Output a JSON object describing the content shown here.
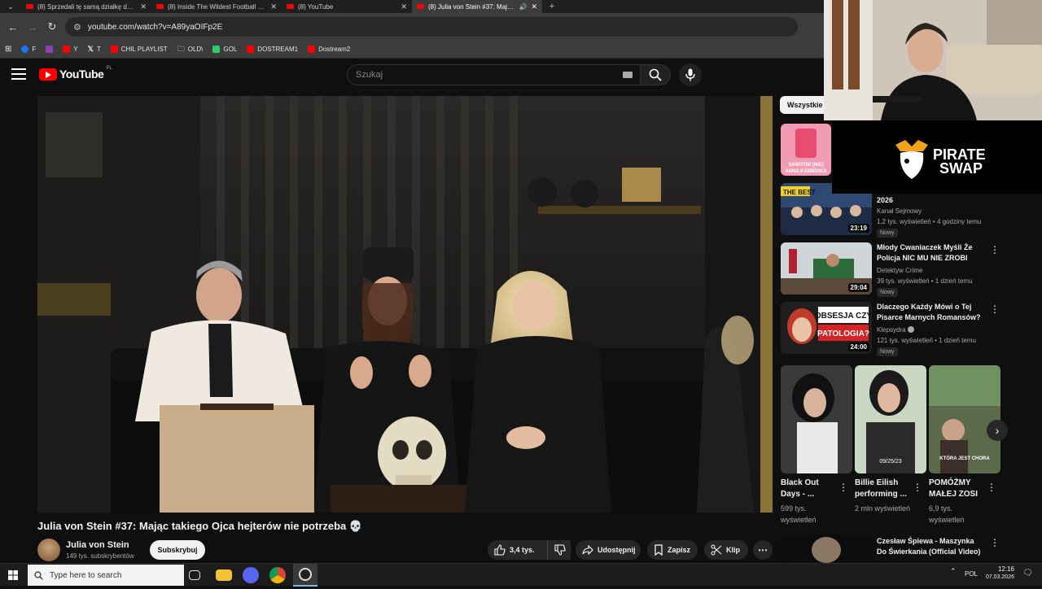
{
  "browser": {
    "tabs": [
      {
        "title": "(8) Sprzedali tę samą działkę dwa razy",
        "active": false
      },
      {
        "title": "(8) Inside The Wildest Football Club",
        "active": false
      },
      {
        "title": "(8) YouTube",
        "active": false
      },
      {
        "title": "(8) Julia von Stein #37: Mając takiego Ojca",
        "active": true
      }
    ],
    "url": "youtube.com/watch?v=A89yaOIFp2E",
    "bookmarks": [
      {
        "label": "F",
        "color": "#1877f2"
      },
      {
        "label": "",
        "color": "#8e44ad"
      },
      {
        "label": "Y",
        "color": "#ff0000"
      },
      {
        "label": "T",
        "color": "#000000"
      },
      {
        "label": "CHIL PLAYLIST",
        "color": "#ff0000"
      },
      {
        "label": "OLD\\",
        "color": "folder"
      },
      {
        "label": "GOL",
        "color": "#2ecc71"
      },
      {
        "label": "DOSTREAM1",
        "color": "#ff0000"
      },
      {
        "label": "Dostream2",
        "color": "#ff0000"
      }
    ]
  },
  "youtube": {
    "logo_text": "YouTube",
    "country": "PL",
    "search_placeholder": "Szukaj"
  },
  "video": {
    "title": "Julia von Stein #37: Mając takiego Ojca hejterów nie potrzeba 💀",
    "channel": "Julia von Stein",
    "subscribers": "149 tys. subskrybentów",
    "subscribe_label": "Subskrybuj",
    "likes": "3,4 tys.",
    "share_label": "Udostępnij",
    "save_label": "Zapisz",
    "clip_label": "Klip"
  },
  "sidebar": {
    "chip_label": "Wszystkie",
    "recommendations": [
      {
        "title": "2026",
        "channel": "Kanał Sejmowy",
        "views": "1,2 tys. wyświetleń • 4 godziny temu",
        "badge": "Nowy",
        "duration": "23:19",
        "thumb_text": "THE BEST"
      },
      {
        "title": "Młody Cwaniaczek Myśli Że Policja NIC MU NIE ZROBI",
        "channel": "Detektyw Crime",
        "views": "39 tys. wyświetleń • 1 dzień temu",
        "badge": "Nowy",
        "duration": "29:04"
      },
      {
        "title": "Dlaczego Każdy Mówi o Tej Pisarce Marnych Romansów?",
        "channel": "Klepsydra",
        "views": "121 tys. wyświetleń • 1 dzień temu",
        "badge": "Nowy",
        "duration": "24:00",
        "thumb_text": "OBSESJA CZY PATOLOGIA?"
      },
      {
        "title": "Czesław Śpiewa - Maszynka Do Świerkania (Official Video)",
        "channel": "",
        "views": "",
        "badge": "",
        "duration": ""
      }
    ],
    "top_thumb_text": "SAMOTNI (NIE) ANNA KAMIŃSKA",
    "shorts": [
      {
        "title": "Black Out Days - ...",
        "views": "599 tys. wyświetleń"
      },
      {
        "title": "Billie Eilish performing ...",
        "views": "2 mln wyświetleń",
        "overlay": "09/25/23"
      },
      {
        "title": "POMÓŻMY MAŁEJ ZOSI",
        "views": "6,9 tys. wyświetleń",
        "overlay": "KTÓRA JEST CHORA"
      }
    ]
  },
  "overlay": {
    "sponsor_line1": "PIRATE",
    "sponsor_line2": "SWAP"
  },
  "taskbar": {
    "search_placeholder": "Type here to search",
    "lang": "POL",
    "time": "12:16",
    "date": "07.03.2026"
  }
}
